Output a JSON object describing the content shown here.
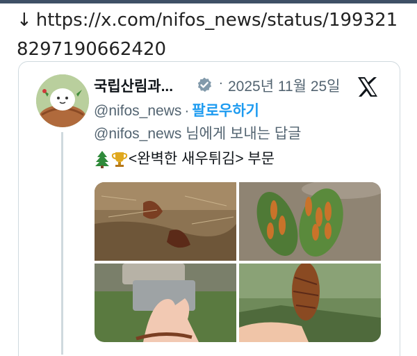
{
  "url": {
    "arrow": "↓",
    "text": "https://x.com/nifos_news/status/1993218297190662420"
  },
  "tweet": {
    "author_name": "국립산림과...",
    "date": "2025년 11월 25일",
    "handle": "@nifos_news",
    "follow_label": "팔로우하기",
    "reply_to_handle": "@nifos_news",
    "reply_to_suffix": " 님에게 보내는 답글",
    "body_text": "<완벽한 새우튀김> 부문",
    "body_emojis": [
      "tree-emoji",
      "trophy-emoji"
    ]
  },
  "colors": {
    "accent": "#1d9bf0",
    "secondary_text": "#536471",
    "border": "#cfd9de"
  },
  "images": [
    {
      "name": "photo-pinecone-ground"
    },
    {
      "name": "photo-pinecones-on-leaves"
    },
    {
      "name": "photo-hand-with-pinecone-scales"
    },
    {
      "name": "photo-held-pinecone"
    }
  ]
}
